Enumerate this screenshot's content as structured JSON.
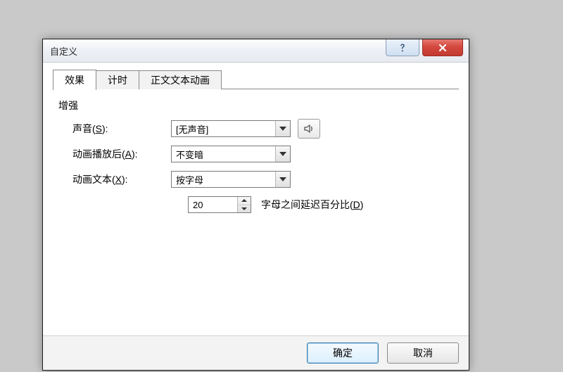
{
  "window": {
    "title": "自定义"
  },
  "tabs": {
    "t1": "效果",
    "t2": "计时",
    "t3": "正文文本动画"
  },
  "group": {
    "enhance": "增强"
  },
  "sound": {
    "label_pre": "声音(",
    "label_u": "S",
    "label_post": "):",
    "value": "[无声音]"
  },
  "after": {
    "label_pre": "动画播放后(",
    "label_u": "A",
    "label_post": "):",
    "value": "不变暗"
  },
  "animtext": {
    "label_pre": "动画文本(",
    "label_u": "X",
    "label_post": "):",
    "value": "按字母"
  },
  "delay": {
    "value": "20",
    "label_pre": "字母之间延迟百分比(",
    "label_u": "D",
    "label_post": ")"
  },
  "buttons": {
    "ok": "确定",
    "cancel": "取消"
  }
}
